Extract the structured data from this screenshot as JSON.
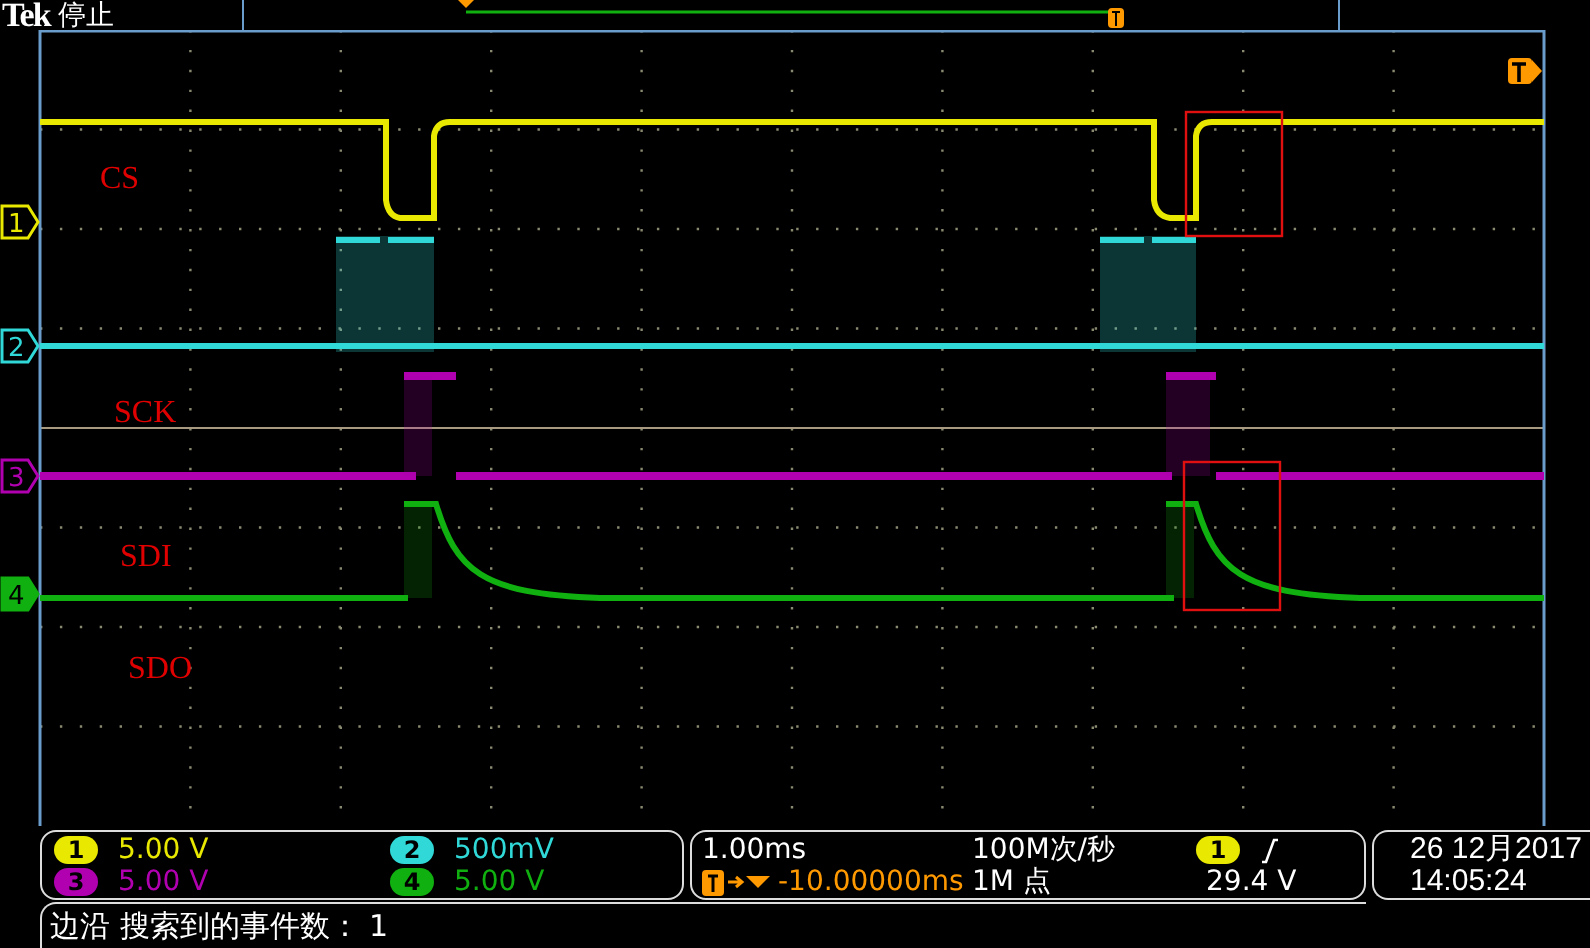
{
  "header": {
    "brand": "Tek",
    "status": "停止"
  },
  "channels": [
    {
      "number": "1",
      "marker": "1",
      "label": "CS",
      "scale": "5.00 V",
      "color": "#e8e800",
      "selected": false
    },
    {
      "number": "2",
      "marker": "2",
      "label": "SCK",
      "scale": "500mV",
      "color": "#30d8d8",
      "selected": false
    },
    {
      "number": "3",
      "marker": "3",
      "label": "SDI",
      "scale": "5.00 V",
      "color": "#b000b0",
      "selected": false
    },
    {
      "number": "4",
      "marker": "4",
      "label": "SDO",
      "scale": "5.00 V",
      "color": "#10b010",
      "selected": true
    }
  ],
  "acquisition": {
    "time_scale": "1.00ms",
    "trigger_delay": "-10.00000ms",
    "sample_rate": "100M次/秒",
    "record_length": "1M 点"
  },
  "trigger": {
    "source": "1",
    "level": "29.4 V"
  },
  "clock": {
    "date": "26 12月2017",
    "time": "14:05:24"
  },
  "status_bar": {
    "message": "边沿 搜索到的事件数： 1"
  }
}
